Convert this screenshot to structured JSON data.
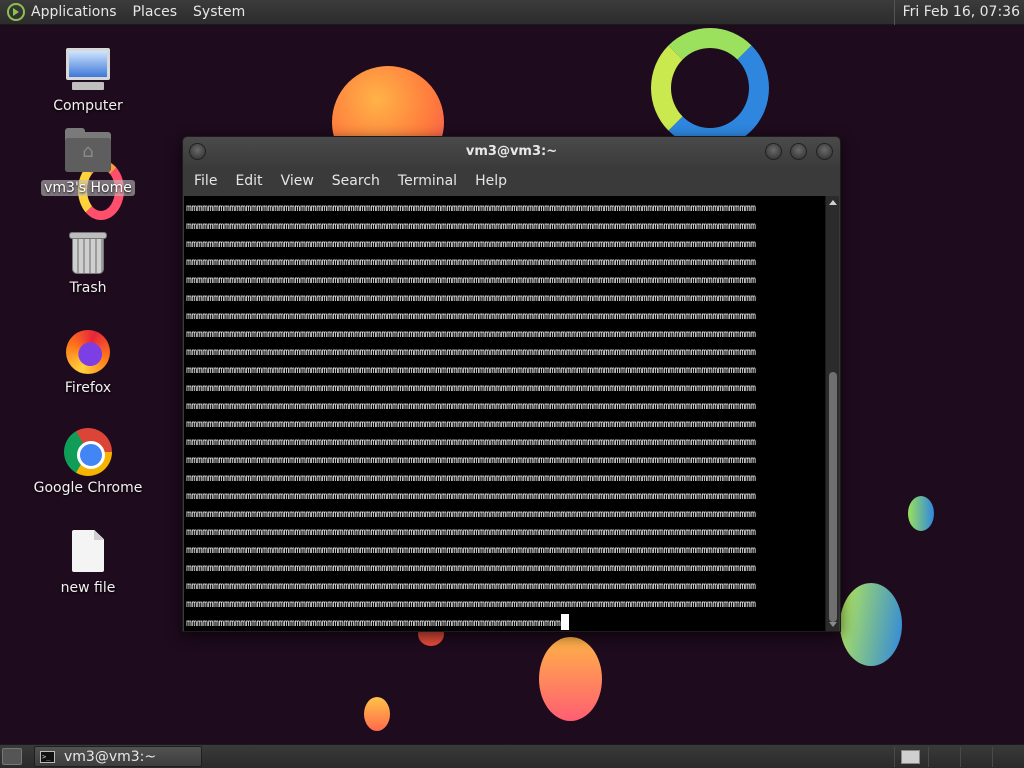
{
  "top_panel": {
    "menus": [
      "Applications",
      "Places",
      "System"
    ],
    "clock": "Fri Feb 16, 07:36"
  },
  "desktop_icons": [
    {
      "label": "Computer",
      "icon": "computer-icon"
    },
    {
      "label": "vm3's Home",
      "icon": "home-folder-icon",
      "selected": true
    },
    {
      "label": "Trash",
      "icon": "trash-icon"
    },
    {
      "label": "Firefox",
      "icon": "firefox-icon"
    },
    {
      "label": "Google Chrome",
      "icon": "chrome-icon"
    },
    {
      "label": "new file",
      "icon": "file-icon"
    }
  ],
  "terminal": {
    "title": "vm3@vm3:~",
    "menus": [
      "File",
      "Edit",
      "View",
      "Search",
      "Terminal",
      "Help"
    ],
    "full_line": "mmmmmmmmmmmmmmmmmmmmmmmmmmmmmmmmmmmmmmmmmmmmmmmmmmmmmmmmmmmmmmmmmmmmmmmmmmmmmmmmmmmmmmmmmmmmmmmmmmmmmmmmm",
    "full_line_count": 23,
    "last_line": "mmmmmmmmmmmmmmmmmmmmmmmmmmmmmmmmmmmmmmmmmmmmmmmmmmmmmmmmmmmmmmmmmmmmm",
    "scroll_position_fraction": 0.55
  },
  "bottom_panel": {
    "task_label": "vm3@vm3:~",
    "workspaces": 4,
    "active_workspace": 1
  },
  "colors": {
    "wallpaper": "#1e0b1d",
    "panel": "#2c2c2c",
    "terminal_bg": "#000000",
    "terminal_fg": "#e8e8e8"
  }
}
